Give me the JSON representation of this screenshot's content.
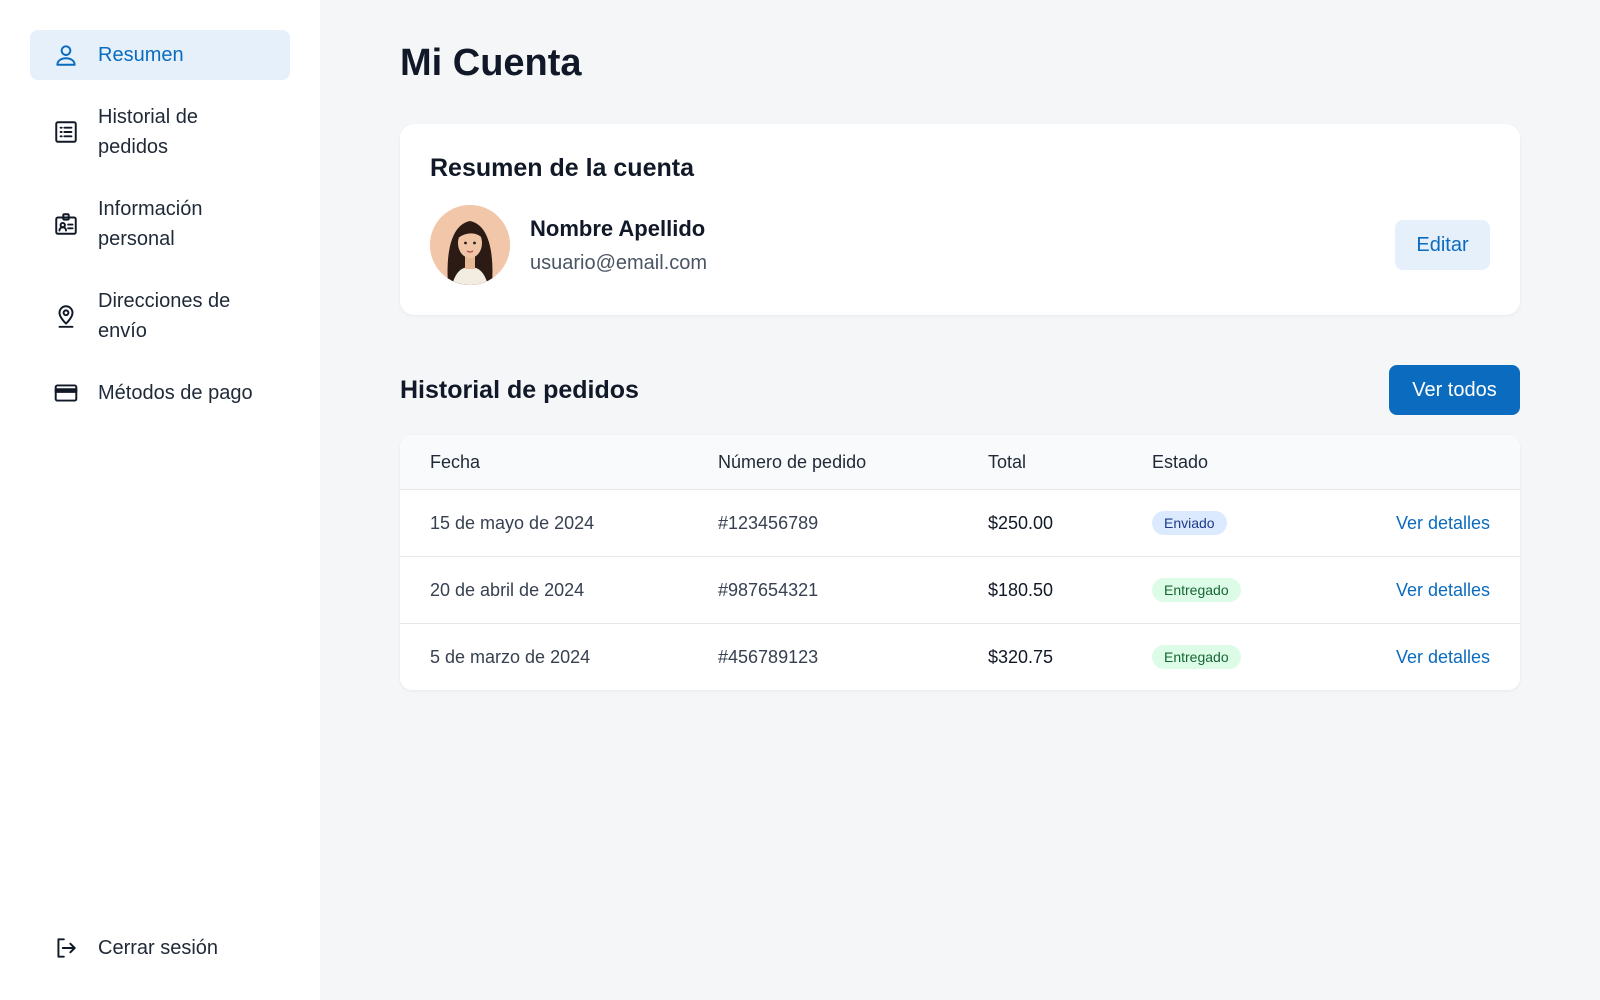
{
  "sidebar": {
    "items": [
      {
        "label": "Resumen",
        "icon": "user-icon",
        "active": true
      },
      {
        "label": "Historial de pedidos",
        "icon": "list-icon",
        "active": false
      },
      {
        "label": "Información personal",
        "icon": "id-card-icon",
        "active": false
      },
      {
        "label": "Direcciones de envío",
        "icon": "location-pin-icon",
        "active": false
      },
      {
        "label": "Métodos de pago",
        "icon": "credit-card-icon",
        "active": false
      }
    ],
    "logout_label": "Cerrar sesión"
  },
  "main": {
    "title": "Mi Cuenta",
    "summary": {
      "title": "Resumen de la cuenta",
      "name": "Nombre Apellido",
      "email": "usuario@email.com",
      "edit_label": "Editar"
    },
    "orders": {
      "title": "Historial de pedidos",
      "view_all_label": "Ver todos",
      "columns": [
        "Fecha",
        "Número de pedido",
        "Total",
        "Estado"
      ],
      "rows": [
        {
          "date": "15 de mayo de 2024",
          "number": "#123456789",
          "total": "$250.00",
          "status": "Enviado",
          "action": "Ver detalles"
        },
        {
          "date": "20 de abril de 2024",
          "number": "#987654321",
          "total": "$180.50",
          "status": "Entregado",
          "action": "Ver detalles"
        },
        {
          "date": "5 de marzo de 2024",
          "number": "#456789123",
          "total": "$320.75",
          "status": "Entregado",
          "action": "Ver detalles"
        }
      ]
    }
  },
  "colors": {
    "accent": "#0b6bbf",
    "accent_light": "#e6f0fa",
    "badge_sent_bg": "#dbeafe",
    "badge_delivered_bg": "#dcfce7"
  }
}
